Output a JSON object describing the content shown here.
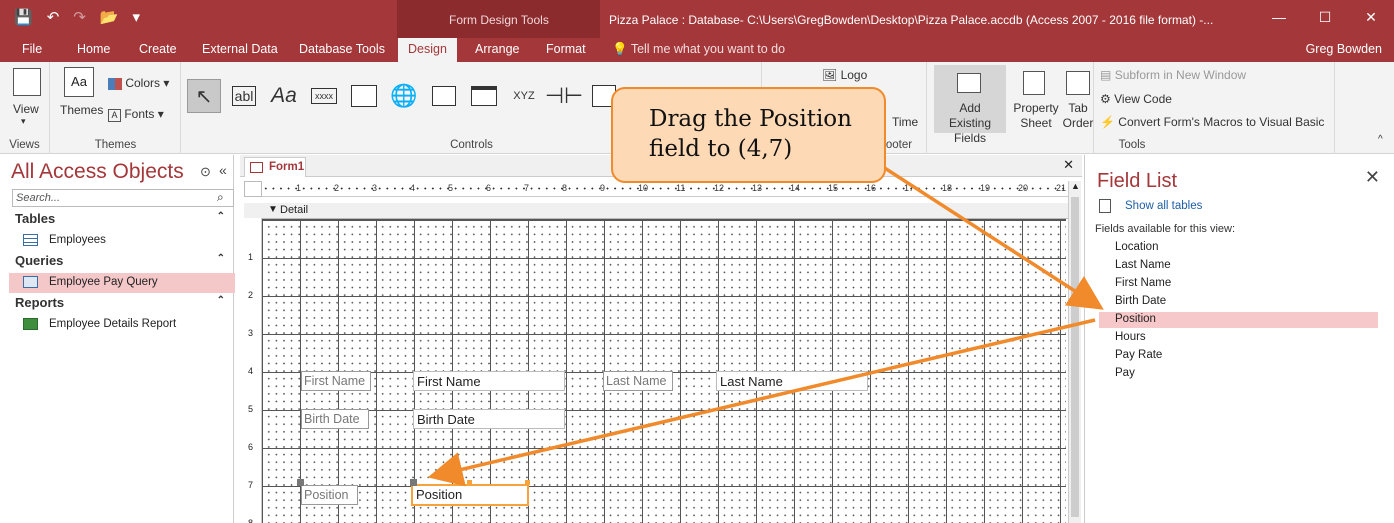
{
  "qat": {
    "save": "💾",
    "undo": "↶",
    "redo": "↷",
    "open": "📂",
    "more": "▾"
  },
  "context_label": "Form Design Tools",
  "window_title": "Pizza Palace : Database- C:\\Users\\GregBowden\\Desktop\\Pizza Palace.accdb (Access 2007 - 2016 file format) -...",
  "window_controls": {
    "min": "—",
    "max": "☐",
    "close": "✕"
  },
  "tabs": [
    "File",
    "Home",
    "Create",
    "External Data",
    "Database Tools",
    "Design",
    "Arrange",
    "Format"
  ],
  "tell_me": "Tell me what you want to do",
  "user": "Greg Bowden",
  "ribbon": {
    "views_btn": "View",
    "views_group": "Views",
    "themes_btn": "Themes",
    "colors_btn": "Colors",
    "fonts_btn": "Fonts",
    "themes_group": "Themes",
    "controls_group": "Controls",
    "ctrl_ab": "abl",
    "ctrl_aa": "Aa",
    "ctrl_xxxx": "xxxx",
    "ctrl_xyz": "XYZ",
    "logo": "Logo",
    "time": "Time",
    "footer_group": "ooter",
    "add_existing": "Add Existing Fields",
    "property_sheet": "Property Sheet",
    "tab_order": "Tab Order",
    "subform": "Subform in New Window",
    "view_code": "View Code",
    "convert_macros": "Convert Form's Macros to Visual Basic",
    "tools_group": "Tools"
  },
  "nav": {
    "title": "All Access Objects",
    "search_placeholder": "Search...",
    "sections": [
      {
        "header": "Tables",
        "items": [
          "Employees"
        ]
      },
      {
        "header": "Queries",
        "items": [
          "Employee Pay Query"
        ]
      },
      {
        "header": "Reports",
        "items": [
          "Employee Details Report"
        ]
      }
    ]
  },
  "form_tab": "Form1",
  "detail_label": "Detail",
  "ruler_numbers": [
    "1",
    "2",
    "3",
    "4",
    "5",
    "6",
    "7",
    "8",
    "9",
    "10",
    "11",
    "12",
    "13",
    "14",
    "15",
    "16",
    "17",
    "18",
    "19",
    "20",
    "21"
  ],
  "vruler_numbers": [
    "1",
    "2",
    "3",
    "4",
    "5",
    "6",
    "7",
    "8"
  ],
  "design_controls": {
    "first_name_label": "First Name",
    "first_name_text": "First Name",
    "last_name_label": "Last Name",
    "last_name_text": "Last Name",
    "birth_date_label": "Birth Date",
    "birth_date_text": "Birth Date",
    "position_label": "Position",
    "position_text": "Position"
  },
  "field_list": {
    "title": "Field List",
    "show_all": "Show all tables",
    "available": "Fields available for this view:",
    "fields": [
      "Location",
      "Last Name",
      "First Name",
      "Birth Date",
      "Position",
      "Hours",
      "Pay Rate",
      "Pay"
    ],
    "selected": "Position"
  },
  "callout": {
    "line1": "Drag the Position",
    "line2": "field to (4,7)"
  },
  "colors": {
    "accent": "#a4373a",
    "callout_fill": "#fdd9b6",
    "callout_border": "#f08a2a",
    "selection": "#f4c7c9"
  }
}
